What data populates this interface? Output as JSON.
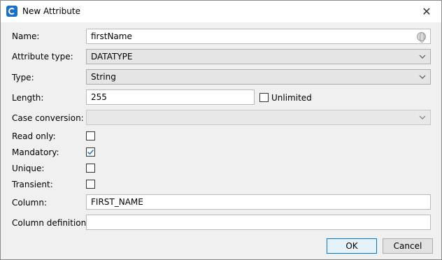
{
  "window": {
    "title": "New Attribute",
    "close_glyph": "✕"
  },
  "form": {
    "name": {
      "label": "Name:",
      "value": "firstName"
    },
    "attribute_type": {
      "label": "Attribute type:",
      "value": "DATATYPE"
    },
    "type": {
      "label": "Type:",
      "value": "String"
    },
    "length": {
      "label": "Length:",
      "value": "255",
      "unlimited_label": "Unlimited",
      "unlimited_checked": false
    },
    "case_conversion": {
      "label": "Case conversion:",
      "value": ""
    },
    "read_only": {
      "label": "Read only:",
      "checked": false
    },
    "mandatory": {
      "label": "Mandatory:",
      "checked": true
    },
    "unique": {
      "label": "Unique:",
      "checked": false
    },
    "transient": {
      "label": "Transient:",
      "checked": false
    },
    "column": {
      "label": "Column:",
      "value": "FIRST_NAME"
    },
    "column_definition": {
      "label": "Column definition:",
      "value": ""
    }
  },
  "buttons": {
    "ok": "OK",
    "cancel": "Cancel"
  },
  "icons": {
    "app": "app-logo-icon",
    "close": "close-icon",
    "localization": "globe-icon",
    "dropdown": "chevron-down-icon",
    "check": "checkmark-icon"
  },
  "colors": {
    "check": "#1b6fc9",
    "default_button_border": "#0078d7"
  }
}
